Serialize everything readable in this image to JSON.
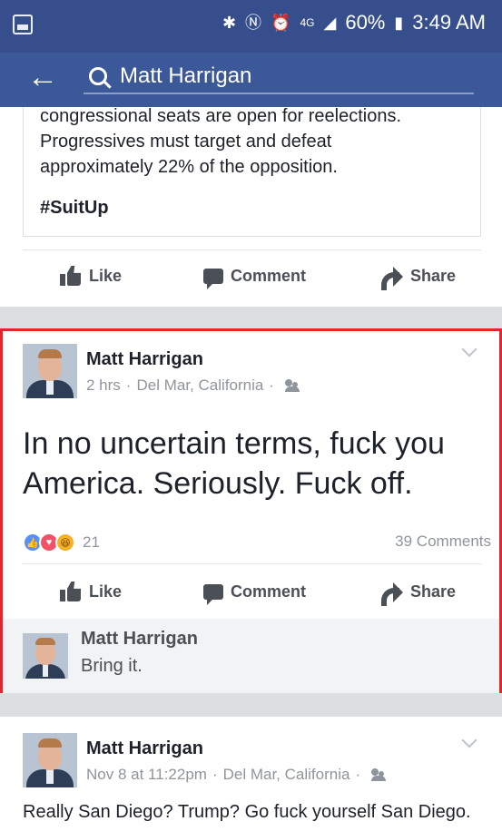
{
  "status_bar": {
    "icons": [
      "image-icon",
      "bluetooth-icon",
      "nfc-icon",
      "alarm-icon",
      "4g-lte-icon",
      "signal-icon"
    ],
    "battery": "60%",
    "time": "3:49 AM"
  },
  "app_bar": {
    "search_query": "Matt Harrigan"
  },
  "shared_post": {
    "text_line1": "congressional seats are open for reelections.",
    "text_line2": "Progressives must target and defeat",
    "text_line3": "approximately 22% of the opposition.",
    "hashtag": "#SuitUp"
  },
  "actions": {
    "like": "Like",
    "comment": "Comment",
    "share": "Share"
  },
  "post": {
    "author": "Matt Harrigan",
    "time": "2 hrs",
    "location": "Del Mar, California",
    "text_line1": "In no uncertain terms, fuck you",
    "text_line2": "America. Seriously. Fuck off.",
    "reaction_count": "21",
    "comment_count": "39 Comments"
  },
  "comment": {
    "author": "Matt Harrigan",
    "text": "Bring it."
  },
  "next_post": {
    "author": "Matt Harrigan",
    "time": "Nov 8 at 11:22pm",
    "location": "Del Mar, California",
    "text": "Really San Diego? Trump? Go fuck yourself San Diego."
  },
  "colors": {
    "facebook_blue": "#3b5998",
    "highlight_border": "#e2252f"
  }
}
